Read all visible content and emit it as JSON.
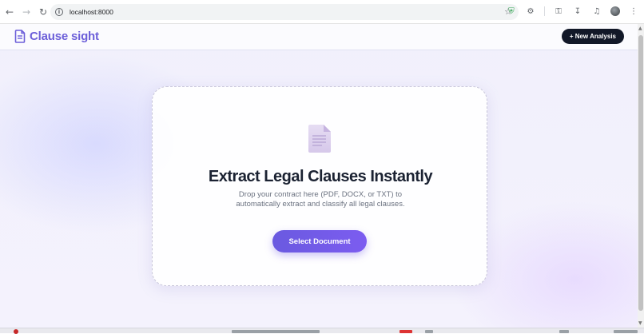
{
  "browser": {
    "url": "localhost:8000",
    "icons": [
      "back-arrow-icon",
      "forward-arrow-icon",
      "reload-icon",
      "site-info-icon",
      "star-icon",
      "shield-extension-icon",
      "puzzle-extension-icon",
      "password-key-icon",
      "download-icon",
      "media-control-icon",
      "profile-avatar-icon",
      "kebab-menu-icon"
    ]
  },
  "header": {
    "brand_name": "Clause sight",
    "new_analysis_label": "+ New Analysis"
  },
  "dropzone": {
    "title": "Extract Legal Clauses Instantly",
    "subtitle": "Drop your contract here (PDF, DOCX, or TXT) to automatically extract and classify all legal clauses.",
    "select_button_label": "Select Document"
  },
  "colors": {
    "brand": "#6c5fd9",
    "button_gradient_start": "#6a5ae0",
    "button_gradient_end": "#7c5cf0",
    "dark_button": "#121828",
    "title_text": "#1b2232",
    "subtitle_text": "#6b7280"
  }
}
